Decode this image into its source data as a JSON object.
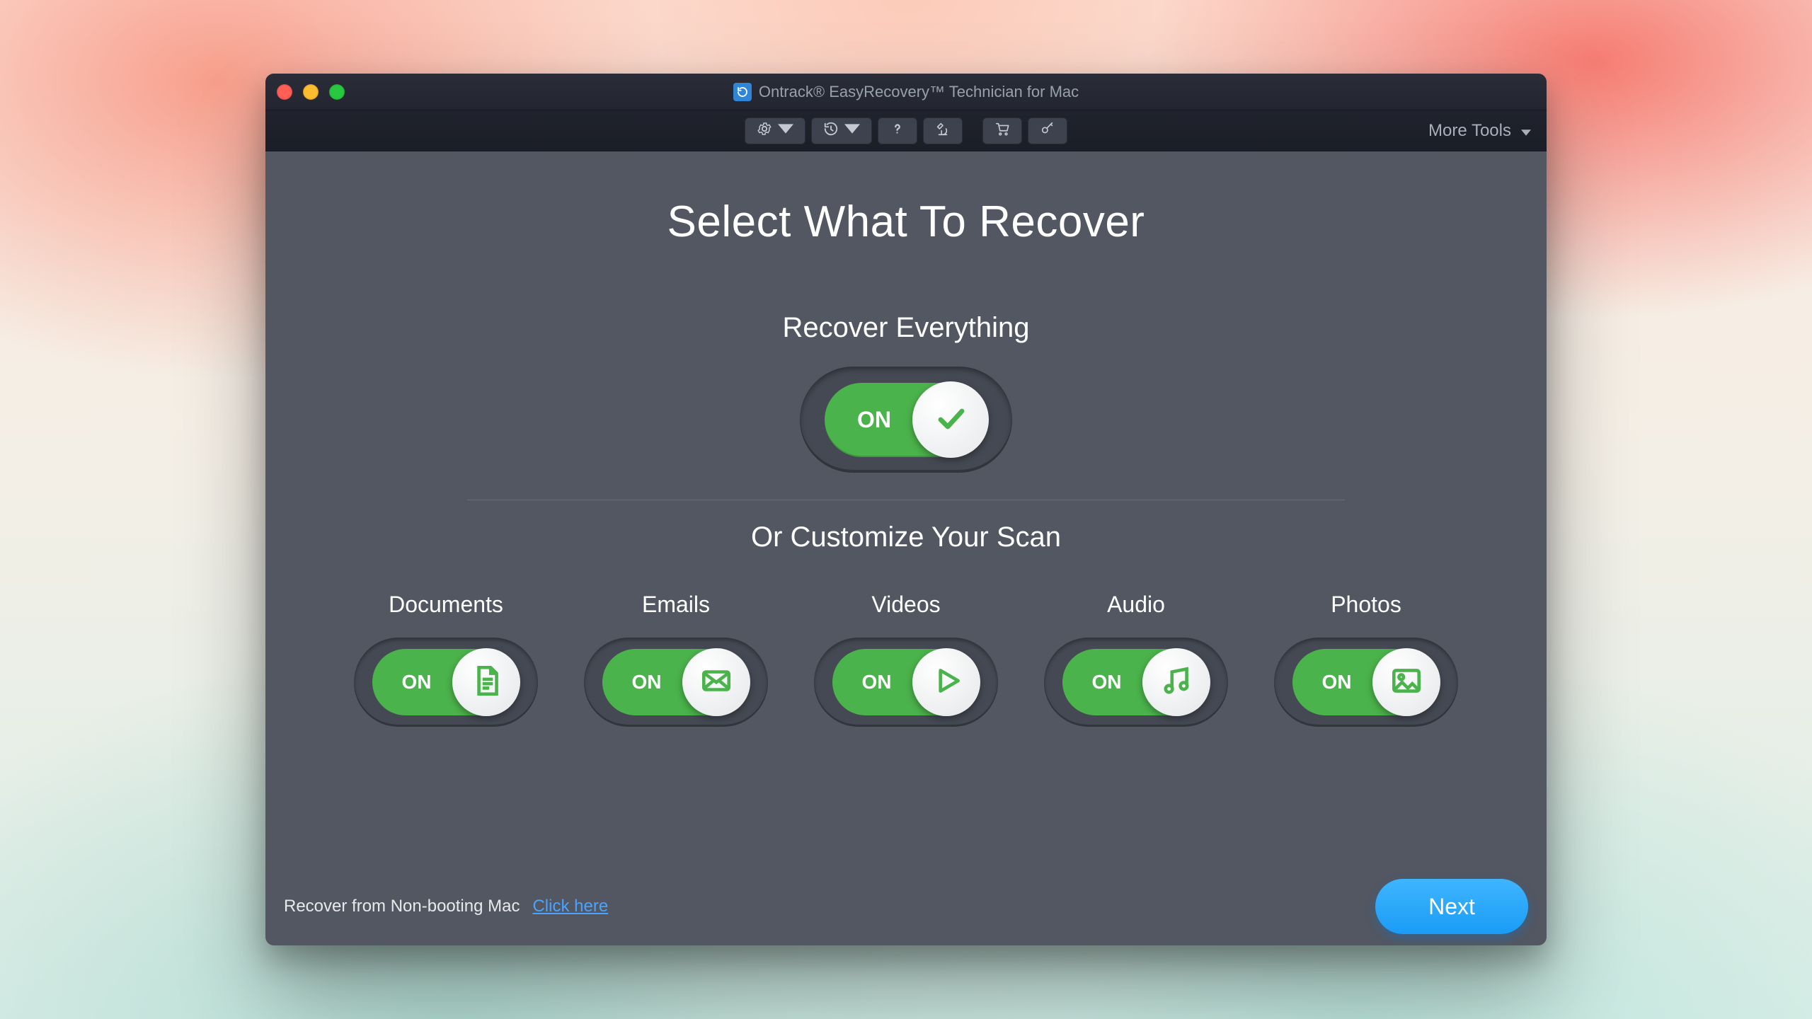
{
  "window": {
    "title": "Ontrack® EasyRecovery™ Technician for Mac"
  },
  "toolbar": {
    "more_tools": "More Tools"
  },
  "main": {
    "heading": "Select What To Recover",
    "recover_everything_label": "Recover Everything",
    "customize_label": "Or Customize Your Scan",
    "on_label": "ON"
  },
  "categories": [
    {
      "label": "Documents",
      "on": "ON",
      "icon": "document-icon"
    },
    {
      "label": "Emails",
      "on": "ON",
      "icon": "email-icon"
    },
    {
      "label": "Videos",
      "on": "ON",
      "icon": "play-icon"
    },
    {
      "label": "Audio",
      "on": "ON",
      "icon": "music-icon"
    },
    {
      "label": "Photos",
      "on": "ON",
      "icon": "image-icon"
    }
  ],
  "footer": {
    "nonboot_label": "Recover from Non-booting Mac",
    "click_here": "Click here",
    "next": "Next"
  }
}
